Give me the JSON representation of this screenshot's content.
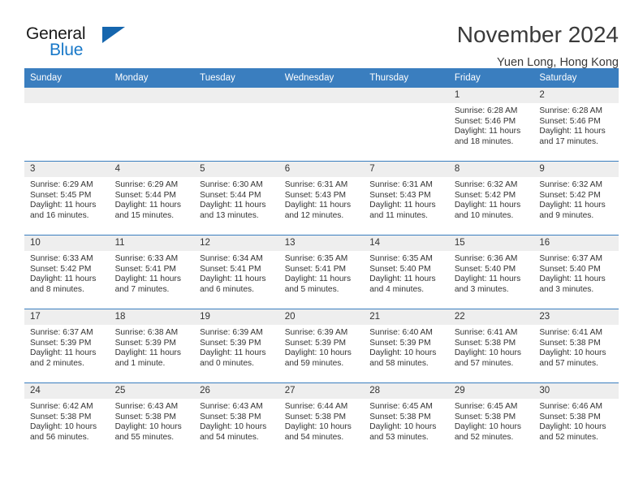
{
  "brand": {
    "name_part1": "General",
    "name_part2": "Blue"
  },
  "header": {
    "title": "November 2024",
    "subtitle": "Yuen Long, Hong Kong"
  },
  "colors": {
    "header_blue": "#3a7ebf",
    "brand_blue": "#1878c8",
    "daynum_background": "#eeeeee"
  },
  "weekdays": [
    "Sunday",
    "Monday",
    "Tuesday",
    "Wednesday",
    "Thursday",
    "Friday",
    "Saturday"
  ],
  "weeks": [
    [
      {
        "day": "",
        "empty": true
      },
      {
        "day": "",
        "empty": true
      },
      {
        "day": "",
        "empty": true
      },
      {
        "day": "",
        "empty": true
      },
      {
        "day": "",
        "empty": true
      },
      {
        "day": "1",
        "sunrise": "Sunrise: 6:28 AM",
        "sunset": "Sunset: 5:46 PM",
        "daylight": "Daylight: 11 hours and 18 minutes."
      },
      {
        "day": "2",
        "sunrise": "Sunrise: 6:28 AM",
        "sunset": "Sunset: 5:46 PM",
        "daylight": "Daylight: 11 hours and 17 minutes."
      }
    ],
    [
      {
        "day": "3",
        "sunrise": "Sunrise: 6:29 AM",
        "sunset": "Sunset: 5:45 PM",
        "daylight": "Daylight: 11 hours and 16 minutes."
      },
      {
        "day": "4",
        "sunrise": "Sunrise: 6:29 AM",
        "sunset": "Sunset: 5:44 PM",
        "daylight": "Daylight: 11 hours and 15 minutes."
      },
      {
        "day": "5",
        "sunrise": "Sunrise: 6:30 AM",
        "sunset": "Sunset: 5:44 PM",
        "daylight": "Daylight: 11 hours and 13 minutes."
      },
      {
        "day": "6",
        "sunrise": "Sunrise: 6:31 AM",
        "sunset": "Sunset: 5:43 PM",
        "daylight": "Daylight: 11 hours and 12 minutes."
      },
      {
        "day": "7",
        "sunrise": "Sunrise: 6:31 AM",
        "sunset": "Sunset: 5:43 PM",
        "daylight": "Daylight: 11 hours and 11 minutes."
      },
      {
        "day": "8",
        "sunrise": "Sunrise: 6:32 AM",
        "sunset": "Sunset: 5:42 PM",
        "daylight": "Daylight: 11 hours and 10 minutes."
      },
      {
        "day": "9",
        "sunrise": "Sunrise: 6:32 AM",
        "sunset": "Sunset: 5:42 PM",
        "daylight": "Daylight: 11 hours and 9 minutes."
      }
    ],
    [
      {
        "day": "10",
        "sunrise": "Sunrise: 6:33 AM",
        "sunset": "Sunset: 5:42 PM",
        "daylight": "Daylight: 11 hours and 8 minutes."
      },
      {
        "day": "11",
        "sunrise": "Sunrise: 6:33 AM",
        "sunset": "Sunset: 5:41 PM",
        "daylight": "Daylight: 11 hours and 7 minutes."
      },
      {
        "day": "12",
        "sunrise": "Sunrise: 6:34 AM",
        "sunset": "Sunset: 5:41 PM",
        "daylight": "Daylight: 11 hours and 6 minutes."
      },
      {
        "day": "13",
        "sunrise": "Sunrise: 6:35 AM",
        "sunset": "Sunset: 5:41 PM",
        "daylight": "Daylight: 11 hours and 5 minutes."
      },
      {
        "day": "14",
        "sunrise": "Sunrise: 6:35 AM",
        "sunset": "Sunset: 5:40 PM",
        "daylight": "Daylight: 11 hours and 4 minutes."
      },
      {
        "day": "15",
        "sunrise": "Sunrise: 6:36 AM",
        "sunset": "Sunset: 5:40 PM",
        "daylight": "Daylight: 11 hours and 3 minutes."
      },
      {
        "day": "16",
        "sunrise": "Sunrise: 6:37 AM",
        "sunset": "Sunset: 5:40 PM",
        "daylight": "Daylight: 11 hours and 3 minutes."
      }
    ],
    [
      {
        "day": "17",
        "sunrise": "Sunrise: 6:37 AM",
        "sunset": "Sunset: 5:39 PM",
        "daylight": "Daylight: 11 hours and 2 minutes."
      },
      {
        "day": "18",
        "sunrise": "Sunrise: 6:38 AM",
        "sunset": "Sunset: 5:39 PM",
        "daylight": "Daylight: 11 hours and 1 minute."
      },
      {
        "day": "19",
        "sunrise": "Sunrise: 6:39 AM",
        "sunset": "Sunset: 5:39 PM",
        "daylight": "Daylight: 11 hours and 0 minutes."
      },
      {
        "day": "20",
        "sunrise": "Sunrise: 6:39 AM",
        "sunset": "Sunset: 5:39 PM",
        "daylight": "Daylight: 10 hours and 59 minutes."
      },
      {
        "day": "21",
        "sunrise": "Sunrise: 6:40 AM",
        "sunset": "Sunset: 5:39 PM",
        "daylight": "Daylight: 10 hours and 58 minutes."
      },
      {
        "day": "22",
        "sunrise": "Sunrise: 6:41 AM",
        "sunset": "Sunset: 5:38 PM",
        "daylight": "Daylight: 10 hours and 57 minutes."
      },
      {
        "day": "23",
        "sunrise": "Sunrise: 6:41 AM",
        "sunset": "Sunset: 5:38 PM",
        "daylight": "Daylight: 10 hours and 57 minutes."
      }
    ],
    [
      {
        "day": "24",
        "sunrise": "Sunrise: 6:42 AM",
        "sunset": "Sunset: 5:38 PM",
        "daylight": "Daylight: 10 hours and 56 minutes."
      },
      {
        "day": "25",
        "sunrise": "Sunrise: 6:43 AM",
        "sunset": "Sunset: 5:38 PM",
        "daylight": "Daylight: 10 hours and 55 minutes."
      },
      {
        "day": "26",
        "sunrise": "Sunrise: 6:43 AM",
        "sunset": "Sunset: 5:38 PM",
        "daylight": "Daylight: 10 hours and 54 minutes."
      },
      {
        "day": "27",
        "sunrise": "Sunrise: 6:44 AM",
        "sunset": "Sunset: 5:38 PM",
        "daylight": "Daylight: 10 hours and 54 minutes."
      },
      {
        "day": "28",
        "sunrise": "Sunrise: 6:45 AM",
        "sunset": "Sunset: 5:38 PM",
        "daylight": "Daylight: 10 hours and 53 minutes."
      },
      {
        "day": "29",
        "sunrise": "Sunrise: 6:45 AM",
        "sunset": "Sunset: 5:38 PM",
        "daylight": "Daylight: 10 hours and 52 minutes."
      },
      {
        "day": "30",
        "sunrise": "Sunrise: 6:46 AM",
        "sunset": "Sunset: 5:38 PM",
        "daylight": "Daylight: 10 hours and 52 minutes."
      }
    ]
  ]
}
